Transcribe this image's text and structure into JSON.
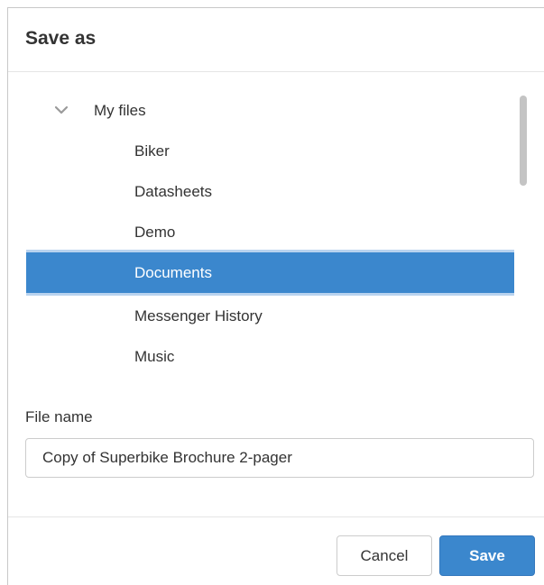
{
  "dialog": {
    "title": "Save as"
  },
  "tree": {
    "root": {
      "label": "My files",
      "expanded": true,
      "icon": "chevron-down-icon"
    },
    "items": [
      {
        "label": "Biker",
        "selected": false
      },
      {
        "label": "Datasheets",
        "selected": false
      },
      {
        "label": "Demo",
        "selected": false
      },
      {
        "label": "Documents",
        "selected": true
      },
      {
        "label": "Messenger History",
        "selected": false
      },
      {
        "label": "Music",
        "selected": false
      }
    ]
  },
  "file_name": {
    "label": "File name",
    "value": "Copy of Superbike Brochure 2-pager"
  },
  "buttons": {
    "cancel": "Cancel",
    "save": "Save"
  },
  "colors": {
    "accent": "#3b87cd",
    "selection_border": "#b9d3ef"
  }
}
